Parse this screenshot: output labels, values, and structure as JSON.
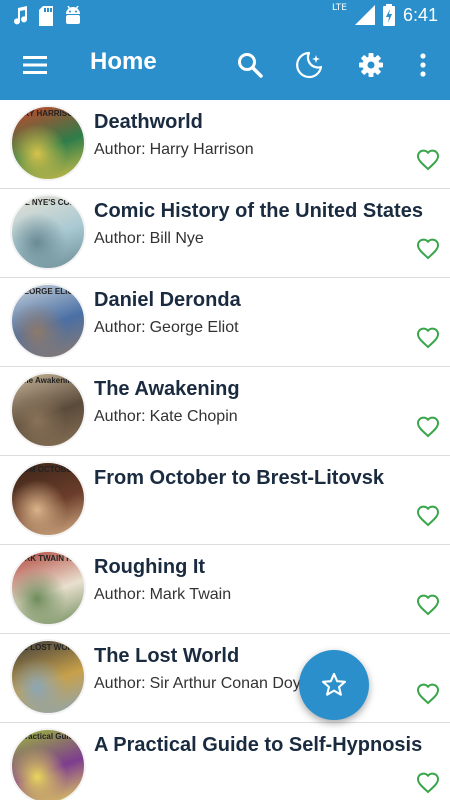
{
  "status_bar": {
    "time": "6:41",
    "network": "LTE",
    "icons": [
      "music-note-icon",
      "sd-card-icon",
      "android-icon",
      "signal-icon",
      "battery-charging-icon"
    ]
  },
  "app_bar": {
    "title": "Home",
    "background": "#2a8fcb",
    "actions": [
      "menu-icon",
      "search-icon",
      "night-mode-icon",
      "settings-icon",
      "more-vert-icon"
    ]
  },
  "author_prefix": "Author:",
  "books": [
    {
      "title": "Deathworld",
      "author": "Harry Harrison",
      "cover_text": "ARRY HARRISON DEATHWORLD",
      "cover_colors": [
        "#2e7d4a",
        "#c9452b",
        "#d8c24a"
      ]
    },
    {
      "title": "Comic History of the United States",
      "author": "Bill Nye",
      "cover_text": "BILL NYE'S COMIC History",
      "cover_colors": [
        "#a9c9d2",
        "#e6e2d5",
        "#6a8a94"
      ]
    },
    {
      "title": "Daniel Deronda",
      "author": "George Eliot",
      "cover_text": "GEORGE ELIOT",
      "cover_colors": [
        "#4a6fa5",
        "#c9d3da",
        "#8f7a6b"
      ]
    },
    {
      "title": "The Awakening",
      "author": "Kate Chopin",
      "cover_text": "The Awakening",
      "cover_colors": [
        "#5a4a3a",
        "#c9b79a",
        "#8a7358"
      ]
    },
    {
      "title": "From October to Brest-Litovsk",
      "author": "",
      "cover_text": "FROM OCTOBER TO BREST-LITOVSK",
      "cover_colors": [
        "#6b3d2a",
        "#3a2418",
        "#d9b48a"
      ]
    },
    {
      "title": "Roughing It",
      "author": "Mark Twain",
      "cover_text": "MARK TWAIN ROUGHING IT",
      "cover_colors": [
        "#e9e0cf",
        "#b0433a",
        "#6e8c5a"
      ]
    },
    {
      "title": "The Lost World",
      "author": "Sir Arthur Conan Doyle",
      "cover_text": "THE LOST WORLD",
      "cover_colors": [
        "#c8a04a",
        "#3a3a3a",
        "#8aa6b8"
      ]
    },
    {
      "title": "A Practical Guide to Self-Hypnosis",
      "author": "",
      "cover_text": "A Practical Guide to Self-Hypnosis",
      "cover_colors": [
        "#7d3c8f",
        "#9dbb3a",
        "#e9d85a"
      ]
    }
  ],
  "favorite_icon_color": "#3aa64b",
  "fab_icon": "star-outline-icon"
}
